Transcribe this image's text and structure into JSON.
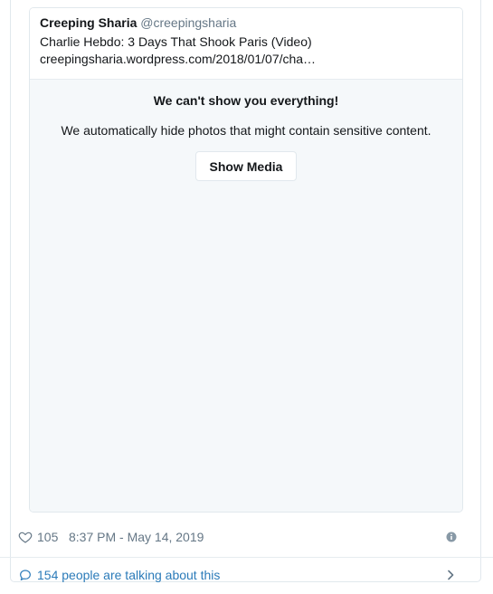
{
  "quoted_tweet": {
    "name": "Creeping Sharia",
    "handle": "@creepingsharia",
    "text": "Charlie Hebdo: 3 Days That Shook Paris (Video)",
    "url": "creepingsharia.wordpress.com/2018/01/07/cha…"
  },
  "sensitive": {
    "title": "We can't show you everything!",
    "description": "We automatically hide photos that might contain sensitive content.",
    "button": "Show Media"
  },
  "footer": {
    "likes": "105",
    "timestamp": "8:37 PM - May 14, 2019"
  },
  "conversation": {
    "label": "154 people are talking about this"
  },
  "icons": {
    "heart": "heart-icon",
    "info": "info-icon",
    "comment": "speech-bubble-icon",
    "chevron": "chevron-right-icon"
  },
  "colors": {
    "link": "#2b7bb9",
    "muted": "#657786",
    "border": "#e1e8ed",
    "media_bg": "#f5f8fa"
  }
}
